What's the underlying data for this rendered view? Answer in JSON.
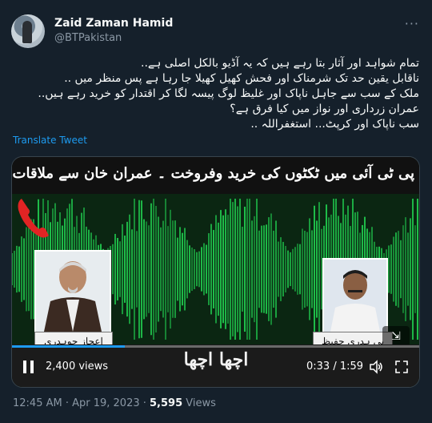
{
  "author": {
    "name": "Zaid Zaman Hamid",
    "handle": "@BTPakistan"
  },
  "more_label": "···",
  "tweet_lines": [
    "تمام شواہد اور آثار بتا رہے ہیں کہ یہ آڈیو بالکل اصلی ہے..",
    "ناقابل یقین حد تک شرمناک اور فحش کھیل کھیلا جا رہا ہے پس منظر میں ..",
    "ملک کے سب سے جاہل ناپاک اور غلیظ لوگ پیسہ لگا کر اقتدار کو خرید رہے ہیں..",
    "عمران زرداری اور نواز میں کیا فرق ہے؟",
    "سب ناپاک اور کرپٹ... استغفراللہ .."
  ],
  "translate_label": "Translate Tweet",
  "video": {
    "banner": "پی ٹی آئی میں ٹکٹوں کی خرید وفروخت ۔ عمران خان سے ملاقات کا اکم سے اکم معاضہ ایک کروڑ روپیہ",
    "caption_left": "اعجاز چوہدری",
    "caption_right": "پی ہدری حفیظ",
    "subtitle": "اچھا اچھا",
    "views": "2,400 views",
    "time": "0:33 / 1:59",
    "progress": 0.277
  },
  "meta": {
    "timestamp": "12:45 AM · Apr 19, 2023 · ",
    "view_count": "5,595",
    "view_label": " Views"
  },
  "colors": {
    "background": "#15202b",
    "accent": "#1d9bf0",
    "wave": "#1fbf4a"
  }
}
